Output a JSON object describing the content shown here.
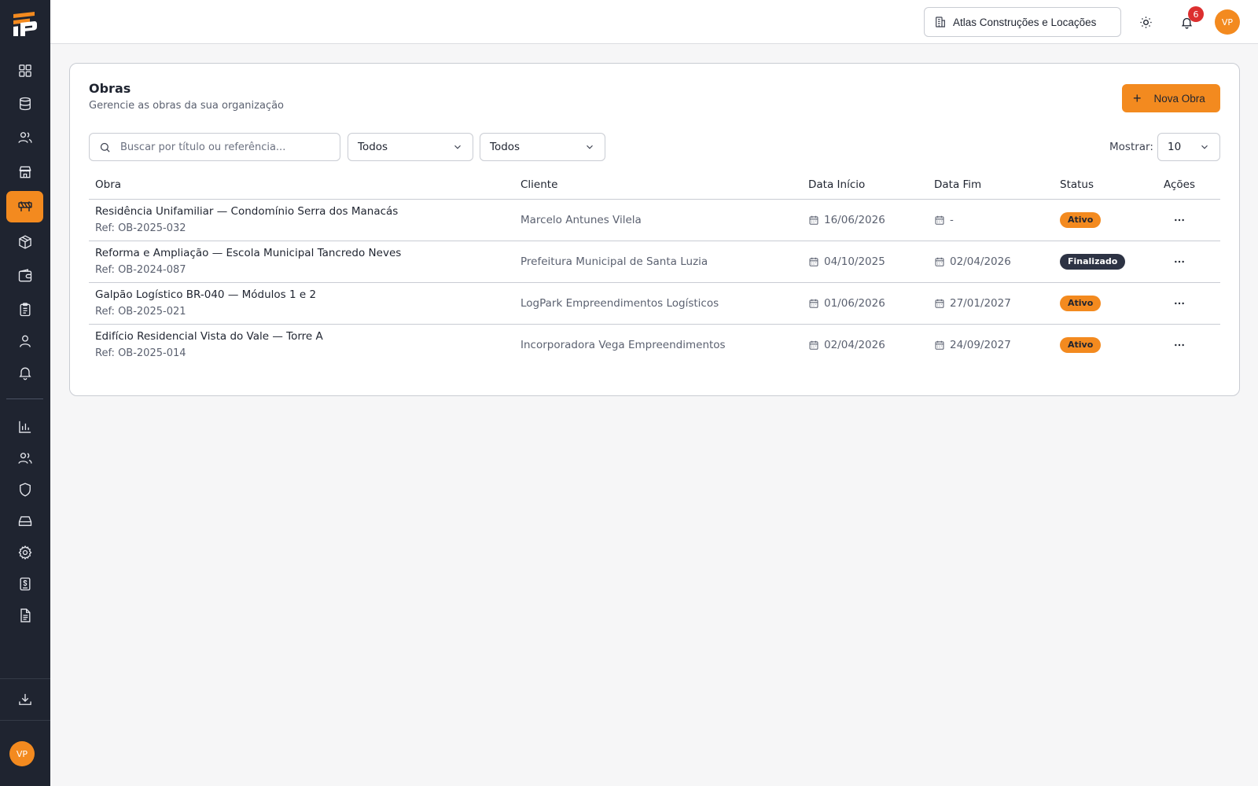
{
  "brand": {
    "accent": "#f38a1f",
    "sidebar_bg": "#1f2430",
    "status_dark": "#2d3344"
  },
  "sidebar": {
    "items": [
      {
        "icon": "dashboard-icon"
      },
      {
        "icon": "database-icon"
      },
      {
        "icon": "users-icon"
      },
      {
        "icon": "store-icon"
      },
      {
        "icon": "construction-icon",
        "active": true
      },
      {
        "icon": "package-icon"
      },
      {
        "icon": "wallet-icon"
      },
      {
        "icon": "clipboard-icon"
      },
      {
        "icon": "user-icon"
      },
      {
        "icon": "bell-icon"
      },
      {
        "icon": "bar-chart-icon"
      },
      {
        "icon": "team-icon"
      },
      {
        "icon": "shield-icon"
      },
      {
        "icon": "hard-drive-icon"
      },
      {
        "icon": "gear-icon"
      },
      {
        "icon": "invoice-icon"
      },
      {
        "icon": "document-icon"
      },
      {
        "icon": "download-icon"
      }
    ],
    "avatar_initials": "VP"
  },
  "topbar": {
    "organization": "Atlas Construções e Locações",
    "notification_count": "6",
    "avatar_initials": "VP"
  },
  "page": {
    "title": "Obras",
    "subtitle": "Gerencie as obras da sua organização",
    "new_button": "Nova Obra"
  },
  "filters": {
    "search_placeholder": "Buscar por título ou referência...",
    "filter1_value": "Todos",
    "filter2_value": "Todos",
    "show_label": "Mostrar:",
    "page_size": "10"
  },
  "table": {
    "headers": {
      "obra": "Obra",
      "cliente": "Cliente",
      "inicio": "Data Início",
      "fim": "Data Fim",
      "status": "Status",
      "acoes": "Ações"
    },
    "rows": [
      {
        "title": "Residência Unifamiliar — Condomínio Serra dos Manacás",
        "ref": "Ref: OB-2025-032",
        "client": "Marcelo Antunes Vilela",
        "start": "16/06/2026",
        "end": "-",
        "status": "Ativo",
        "status_kind": "ativo"
      },
      {
        "title": "Reforma e Ampliação — Escola Municipal Tancredo Neves",
        "ref": "Ref: OB-2024-087",
        "client": "Prefeitura Municipal de Santa Luzia",
        "start": "04/10/2025",
        "end": "02/04/2026",
        "status": "Finalizado",
        "status_kind": "finalizado"
      },
      {
        "title": "Galpão Logístico BR-040 — Módulos 1 e 2",
        "ref": "Ref: OB-2025-021",
        "client": "LogPark Empreendimentos Logísticos",
        "start": "01/06/2026",
        "end": "27/01/2027",
        "status": "Ativo",
        "status_kind": "ativo"
      },
      {
        "title": "Edifício Residencial Vista do Vale — Torre A",
        "ref": "Ref: OB-2025-014",
        "client": "Incorporadora Vega Empreendimentos",
        "start": "02/04/2026",
        "end": "24/09/2027",
        "status": "Ativo",
        "status_kind": "ativo"
      }
    ]
  }
}
